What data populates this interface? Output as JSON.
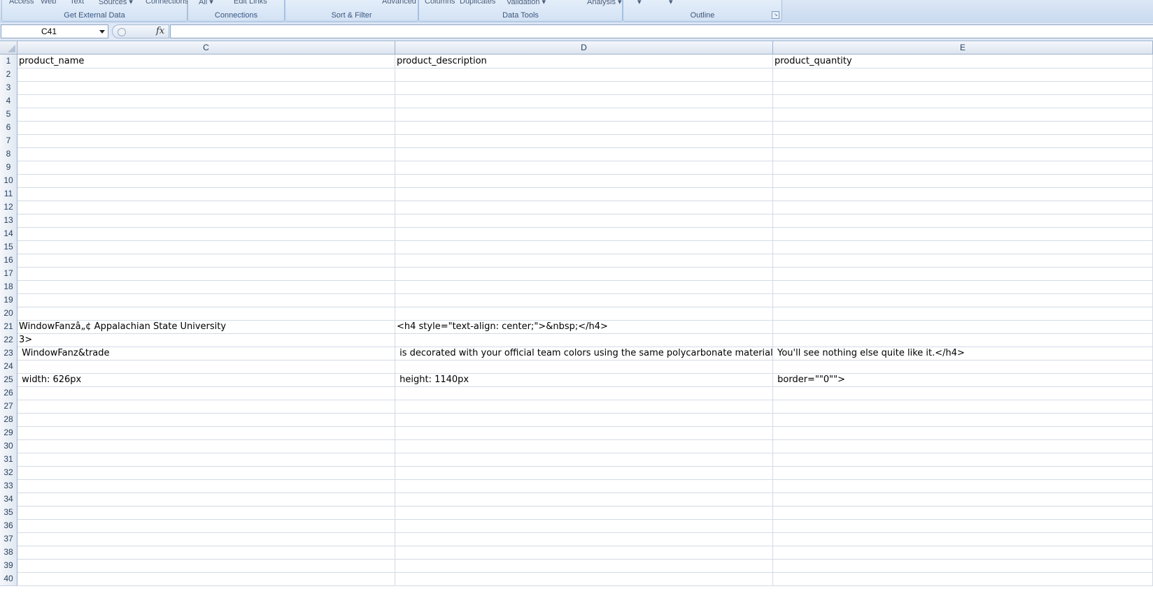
{
  "ribbon": {
    "groups": [
      {
        "title": "Get External Data",
        "commands": [
          "Access",
          "Web",
          "Text",
          "Sources ▾",
          "Connections"
        ]
      },
      {
        "title": "Connections",
        "commands": [
          "All ▾",
          "Edit Links"
        ]
      },
      {
        "title": "Sort & Filter",
        "commands": [
          "Advanced"
        ]
      },
      {
        "title": "Data Tools",
        "commands": [
          "Columns",
          "Duplicates",
          "Validation ▾",
          "Analysis ▾"
        ]
      },
      {
        "title": "Outline",
        "commands": [
          "▾",
          "▾"
        ]
      }
    ]
  },
  "formula_bar": {
    "name_box": "C41",
    "fx_icon": "fx-icon",
    "formula": ""
  },
  "columns": [
    "C",
    "D",
    "E"
  ],
  "row_count": 40,
  "cells": {
    "1": [
      "product_name",
      "product_description",
      "product_quantity"
    ],
    "21": [
      "WindowFanzâ„¢ Appalachian State University",
      "<h4 style=\"text-align: center;\">&nbsp;</h4>",
      ""
    ],
    "22": [
      "3>",
      "",
      ""
    ],
    "23": [
      " WindowFanz&trade",
      " is decorated with your official team colors using the same polycarbonate material as a real football helmet.",
      " You'll see nothing else quite like it.</h4>"
    ],
    "25": [
      " width: 626px",
      " height: 1140px",
      " border=\"\"0\"\">"
    ]
  }
}
